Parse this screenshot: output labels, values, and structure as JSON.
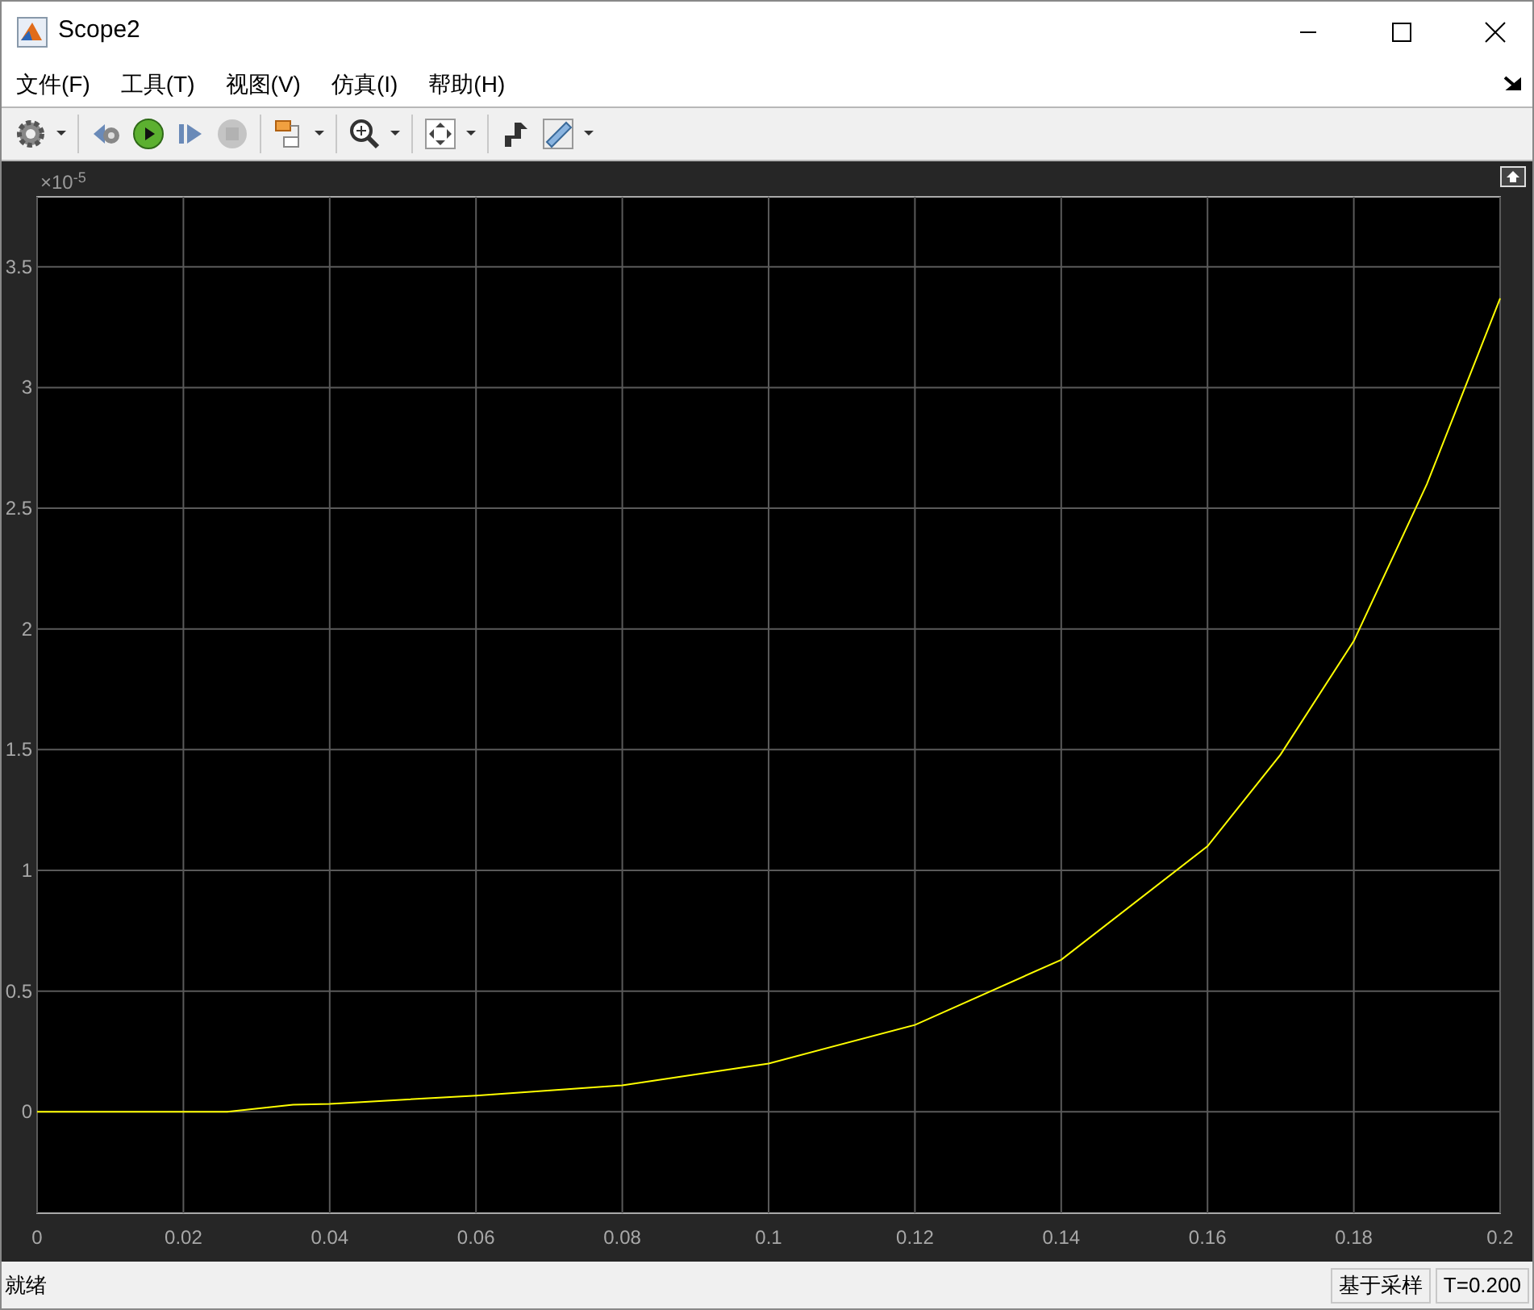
{
  "window": {
    "title": "Scope2"
  },
  "menu": [
    {
      "label": "文件(F)"
    },
    {
      "label": "工具(T)"
    },
    {
      "label": "视图(V)"
    },
    {
      "label": "仿真(I)"
    },
    {
      "label": "帮助(H)"
    }
  ],
  "toolbar": [
    {
      "kind": "settings",
      "dropdown": true
    },
    {
      "kind": "separator"
    },
    {
      "kind": "step_back"
    },
    {
      "kind": "run"
    },
    {
      "kind": "step_forward"
    },
    {
      "kind": "stop",
      "disabled": true
    },
    {
      "kind": "separator"
    },
    {
      "kind": "highlight",
      "dropdown": true
    },
    {
      "kind": "separator"
    },
    {
      "kind": "zoom",
      "dropdown": true
    },
    {
      "kind": "separator"
    },
    {
      "kind": "fit",
      "dropdown": true
    },
    {
      "kind": "separator"
    },
    {
      "kind": "triggers"
    },
    {
      "kind": "measure",
      "dropdown": true
    }
  ],
  "plot": {
    "y_multiplier": "×10$^{-5}$",
    "chart_data": {
      "type": "line",
      "grid": true,
      "xlim": [
        0,
        0.2
      ],
      "ylim": [
        -0.42,
        3.79
      ],
      "xticks": [
        {
          "value": 0,
          "label": "0"
        },
        {
          "value": 0.02,
          "label": "0.02"
        },
        {
          "value": 0.04,
          "label": "0.04"
        },
        {
          "value": 0.06,
          "label": "0.06"
        },
        {
          "value": 0.08,
          "label": "0.08"
        },
        {
          "value": 0.1,
          "label": "0.1"
        },
        {
          "value": 0.12,
          "label": "0.12"
        },
        {
          "value": 0.14,
          "label": "0.14"
        },
        {
          "value": 0.16,
          "label": "0.16"
        },
        {
          "value": 0.18,
          "label": "0.18"
        },
        {
          "value": 0.2,
          "label": "0.2"
        }
      ],
      "yticks": [
        {
          "value": 0,
          "label": "0"
        },
        {
          "value": 0.5,
          "label": "0.5"
        },
        {
          "value": 1,
          "label": "1"
        },
        {
          "value": 1.5,
          "label": "1.5"
        },
        {
          "value": 2,
          "label": "2"
        },
        {
          "value": 2.5,
          "label": "2.5"
        },
        {
          "value": 3,
          "label": "3"
        },
        {
          "value": 3.5,
          "label": "3.5"
        }
      ],
      "x": [
        0,
        0.026,
        0.035,
        0.04,
        0.06,
        0.08,
        0.1,
        0.12,
        0.14,
        0.16,
        0.17,
        0.18,
        0.19,
        0.2
      ],
      "series": [
        {
          "color": "#ffff00",
          "values": [
            0,
            0,
            0.03,
            0.033,
            0.067,
            0.11,
            0.2,
            0.36,
            0.63,
            1.1,
            1.48,
            1.95,
            2.6,
            3.37
          ]
        }
      ]
    }
  },
  "status_bar": {
    "message": "就绪",
    "mode": "基于采样",
    "time": "T=0.200"
  }
}
